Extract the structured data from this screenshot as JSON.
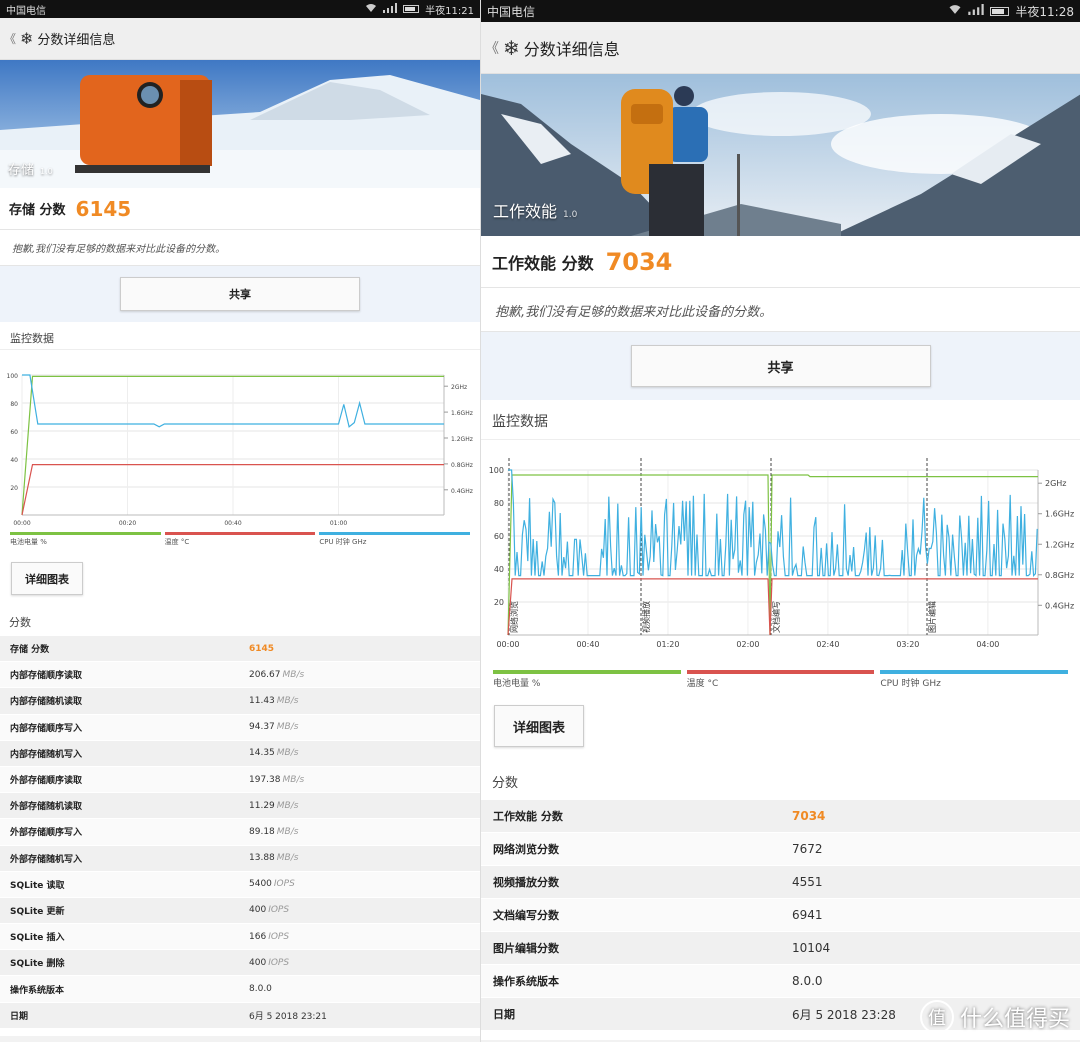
{
  "left": {
    "status": {
      "carrier": "中国电信",
      "time": "半夜11:21"
    },
    "appbar": {
      "back": "《",
      "title": "分数详细信息"
    },
    "hero": {
      "caption": "存储",
      "version": "1.0"
    },
    "score": {
      "label": "存储 分数",
      "value": "6145"
    },
    "note": "抱歉,我们没有足够的数据来对比此设备的分数。",
    "share": "共享",
    "monitor_title": "监控数据",
    "detail_button": "详细图表",
    "scores_title": "分数",
    "legend": [
      "电池电量 %",
      "温度 °C",
      "CPU 时钟 GHz"
    ],
    "rows": [
      {
        "k": "存储 分数",
        "v": "6145",
        "u": ""
      },
      {
        "k": "内部存储顺序读取",
        "v": "206.67",
        "u": "MB/s"
      },
      {
        "k": "内部存储随机读取",
        "v": "11.43",
        "u": "MB/s"
      },
      {
        "k": "内部存储顺序写入",
        "v": "94.37",
        "u": "MB/s"
      },
      {
        "k": "内部存储随机写入",
        "v": "14.35",
        "u": "MB/s"
      },
      {
        "k": "外部存储顺序读取",
        "v": "197.38",
        "u": "MB/s"
      },
      {
        "k": "外部存储随机读取",
        "v": "11.29",
        "u": "MB/s"
      },
      {
        "k": "外部存储顺序写入",
        "v": "89.18",
        "u": "MB/s"
      },
      {
        "k": "外部存储随机写入",
        "v": "13.88",
        "u": "MB/s"
      },
      {
        "k": "SQLite 读取",
        "v": "5400",
        "u": "IOPS"
      },
      {
        "k": "SQLite 更新",
        "v": "400",
        "u": "IOPS"
      },
      {
        "k": "SQLite 插入",
        "v": "166",
        "u": "IOPS"
      },
      {
        "k": "SQLite 删除",
        "v": "400",
        "u": "IOPS"
      },
      {
        "k": "操作系统版本",
        "v": "8.0.0",
        "u": ""
      },
      {
        "k": "日期",
        "v": "6月 5 2018 23:21",
        "u": ""
      }
    ]
  },
  "right": {
    "status": {
      "carrier": "中国电信",
      "time": "半夜11:28"
    },
    "appbar": {
      "back": "《",
      "title": "分数详细信息"
    },
    "hero": {
      "caption": "工作效能",
      "version": "1.0"
    },
    "score": {
      "label": "工作效能 分数",
      "value": "7034"
    },
    "note": "抱歉,我们没有足够的数据来对比此设备的分数。",
    "share": "共享",
    "monitor_title": "监控数据",
    "detail_button": "详细图表",
    "scores_title": "分数",
    "legend": [
      "电池电量 %",
      "温度 °C",
      "CPU 时钟 GHz"
    ],
    "rows": [
      {
        "k": "工作效能 分数",
        "v": "7034",
        "u": ""
      },
      {
        "k": "网络浏览分数",
        "v": "7672",
        "u": ""
      },
      {
        "k": "视频播放分数",
        "v": "4551",
        "u": ""
      },
      {
        "k": "文档编写分数",
        "v": "6941",
        "u": ""
      },
      {
        "k": "图片编辑分数",
        "v": "10104",
        "u": ""
      },
      {
        "k": "操作系统版本",
        "v": "8.0.0",
        "u": ""
      },
      {
        "k": "日期",
        "v": "6月 5 2018 23:28",
        "u": ""
      }
    ]
  },
  "watermark": {
    "text": "什么值得买",
    "mark": "值"
  },
  "colors": {
    "accent": "#f08a24",
    "battery": "#7dc243",
    "temp": "#d9534f",
    "cpu": "#3fb0e0"
  },
  "chart_data": [
    {
      "type": "line",
      "title": "",
      "xlabel": "",
      "ylabel": "",
      "x_ticks": [
        "00:00",
        "00:20",
        "00:40",
        "01:00"
      ],
      "y_ticks": [
        20,
        40,
        60,
        80,
        100
      ],
      "y2_ticks": [
        "0.4GHz",
        "0.8GHz",
        "1.2GHz",
        "1.6GHz",
        "2GHz"
      ],
      "xlim": [
        0,
        80
      ],
      "ylim": [
        0,
        100
      ],
      "series": [
        {
          "name": "电池电量 %",
          "color": "#7dc243",
          "x": [
            0,
            2,
            80
          ],
          "y": [
            0,
            99,
            99
          ]
        },
        {
          "name": "温度 °C",
          "color": "#d9534f",
          "x": [
            0,
            2,
            80
          ],
          "y": [
            0,
            36,
            36
          ]
        },
        {
          "name": "CPU 时钟 GHz",
          "color": "#3fb0e0",
          "x": [
            0,
            1.5,
            3,
            25,
            26,
            27,
            60,
            61,
            62,
            63,
            64,
            65,
            66,
            80
          ],
          "y": [
            100,
            100,
            65,
            65,
            63,
            65,
            65,
            79,
            63,
            66,
            80,
            65,
            65,
            65
          ]
        }
      ]
    },
    {
      "type": "line",
      "title": "",
      "xlabel": "",
      "ylabel": "",
      "x_ticks": [
        "00:00",
        "00:40",
        "01:20",
        "02:00",
        "02:40",
        "03:20",
        "04:00"
      ],
      "y_ticks": [
        20,
        40,
        60,
        80,
        100
      ],
      "y2_ticks": [
        "0.4GHz",
        "0.8GHz",
        "1.2GHz",
        "1.6GHz",
        "2GHz"
      ],
      "xlim": [
        0,
        265
      ],
      "ylim": [
        0,
        100
      ],
      "markers": [
        {
          "x": 0,
          "label": "网络浏览"
        },
        {
          "x": 66,
          "label": "视频播放"
        },
        {
          "x": 131,
          "label": "文档编写"
        },
        {
          "x": 209,
          "label": "图片编辑"
        }
      ],
      "series": [
        {
          "name": "电池电量 %",
          "color": "#7dc243",
          "x": [
            0,
            2,
            130,
            131,
            132,
            150,
            151,
            265
          ],
          "y": [
            0,
            97,
            97,
            0,
            97,
            97,
            96,
            96
          ]
        },
        {
          "name": "温度 °C",
          "color": "#d9534f",
          "x": [
            0,
            2,
            130,
            131,
            132,
            265
          ],
          "y": [
            0,
            34,
            34,
            0,
            34,
            34
          ]
        },
        {
          "name": "CPU 时钟 GHz",
          "color": "#3fb0e0",
          "x": [],
          "y": []
        }
      ]
    }
  ]
}
